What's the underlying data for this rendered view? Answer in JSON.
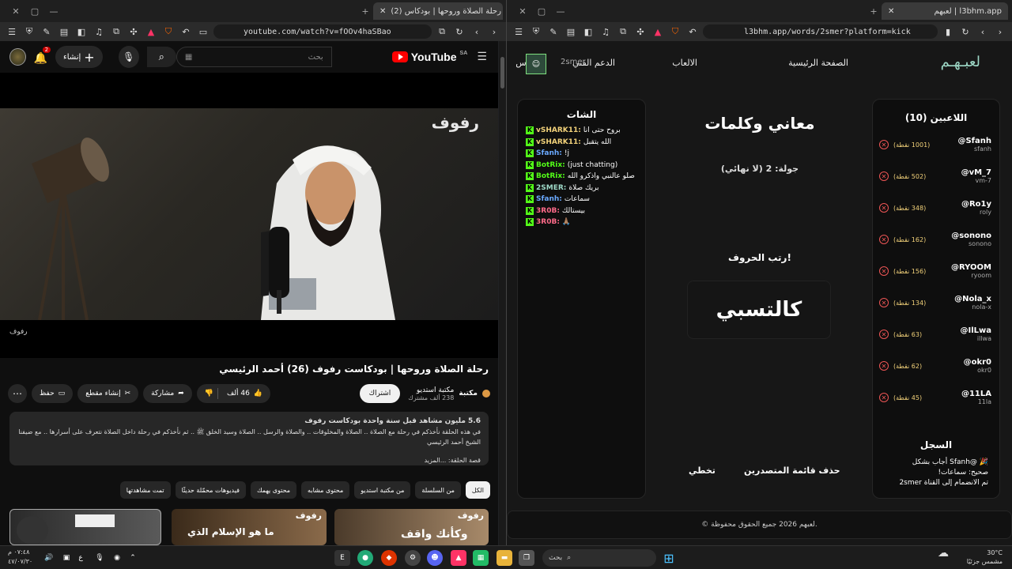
{
  "left_window": {
    "tab_title": "(2) رحلة الصلاة وروحها | بودكاس",
    "url": "youtube.com/watch?v=fOOv4haSBao",
    "youtube": {
      "logo_text": "YouTube",
      "region": "SA",
      "search_placeholder": "بحث",
      "create_label": "إنشاء",
      "notif_count": "2",
      "video_watermark": "رفوف",
      "video_caption": "رفوف",
      "title": "رحلة الصلاة وروحها | بودكاست رفوف (26) أحمد الرئيسي",
      "channel_name": "مكتبة استديو",
      "channel_subs": "238 ألف مشترك",
      "library_label": "مكتبة",
      "subscribe_label": "اشتراك",
      "likes": "46 ألف",
      "share_label": "مشاركة",
      "clip_label": "إنشاء مقطع",
      "save_label": "حفظ",
      "views_line": "5.6 مليون مشاهد  قبل سنة واحدة  بودكاست رفوف",
      "desc_line": "في هذه الحلقة نأخذكم في رحلة مع الصلاة .. الصلاة والمخلوقات .. والصلاة والرسل .. الصلاة وسيد الخلق ﷺ .. ثم نأخذكم في رحلة داخل الصلاة نتعرف على أسرارها .. مع ضيفنا الشيخ أحمد الرئيسي",
      "desc_more": "قصة الحلقة: ...المزيد",
      "chips": [
        "الكل",
        "من السلسلة",
        "من مكتبة استديو",
        "محتوى مشابه",
        "محتوى يهمك",
        "فيديوهات محمّلة حديثًا",
        "تمت مشاهدتها"
      ],
      "thumb_texts": [
        "وكأنك واقف",
        "ما هو الإسلام الذي",
        "رفوف",
        "رفوف"
      ]
    }
  },
  "right_window": {
    "tab_title": "لعبهم | l3bhm.app",
    "url": "l3bhm.app/words/2smer?platform=kick",
    "site": {
      "logo": "لعبـهـم",
      "nav": [
        "الصفحة الرئيسية",
        "الالعاب",
        "الدعم الفني",
        "الاس"
      ],
      "user_label": "2smer",
      "players_title": "اللاعبين (10)",
      "players": [
        {
          "name": "@Sfanh",
          "handle": "sfanh",
          "points": "(1001 نقطة)"
        },
        {
          "name": "@vM_7",
          "handle": "vm-7",
          "points": "(502 نقطة)"
        },
        {
          "name": "@Ro1y",
          "handle": "roly",
          "points": "(348 نقطة)"
        },
        {
          "name": "@sonono",
          "handle": "sonono",
          "points": "(162 نقطة)"
        },
        {
          "name": "@RYOOM",
          "handle": "ryoom",
          "points": "(156 نقطة)"
        },
        {
          "name": "@Nola_x",
          "handle": "nola-x",
          "points": "(134 نقطة)"
        },
        {
          "name": "@IlLwa",
          "handle": "illwa",
          "points": "(63 نقطة)"
        },
        {
          "name": "@okr0",
          "handle": "okr0",
          "points": "(62 نقطة)"
        },
        {
          "name": "@11LA",
          "handle": "11la",
          "points": "(45 نقطة)"
        }
      ],
      "log_title": "السجل",
      "log_lines": [
        "🎉 @Sfanh أجاب بشكل",
        "صحيح: سماعات!",
        "تم الانضمام إلى القناة 2smer"
      ],
      "game_title": "معاني وكلمات",
      "round": "جولة: 2 (لا نهائي)",
      "arrange_label": "رتب الحروف!",
      "scrambled_word": "كالتسبي",
      "skip_label": "تخطي",
      "clear_label": "حذف قائمة المتصدرين",
      "chat_title": "الشات",
      "chat": [
        {
          "user": "vSHARK11:",
          "text": "بروح حتى انا",
          "color": "#f3d27a"
        },
        {
          "user": "vSHARK11:",
          "text": "الله يتقبل",
          "color": "#f3d27a"
        },
        {
          "user": "Sfanh:",
          "text": "!j",
          "color": "#6aa9ff"
        },
        {
          "user": "BotRix:",
          "text": "(just chatting)",
          "color": "#53fc18"
        },
        {
          "user": "BotRix:",
          "text": "صلو عالنبي واذكرو الله",
          "color": "#53fc18"
        },
        {
          "user": "2SMER:",
          "text": "بريك صلاة",
          "color": "#9ed9c7"
        },
        {
          "user": "Sfanh:",
          "text": "سماعات",
          "color": "#6aa9ff"
        },
        {
          "user": "3R0B:",
          "text": "بيستالك",
          "color": "#ff6b8a"
        },
        {
          "user": "3R0B:",
          "text": "🙏🏽",
          "color": "#ff6b8a"
        }
      ],
      "footer": "© لعبهم 2026 جميع الحقوق محفوظة."
    }
  },
  "taskbar": {
    "search_placeholder": "بحث",
    "time": "٠٧:٤٨ م",
    "date": "٤٧/٠٧/٣٠",
    "lang": "ع",
    "weather_temp": "30°C",
    "weather_desc": "مشمس جزئيًا"
  }
}
